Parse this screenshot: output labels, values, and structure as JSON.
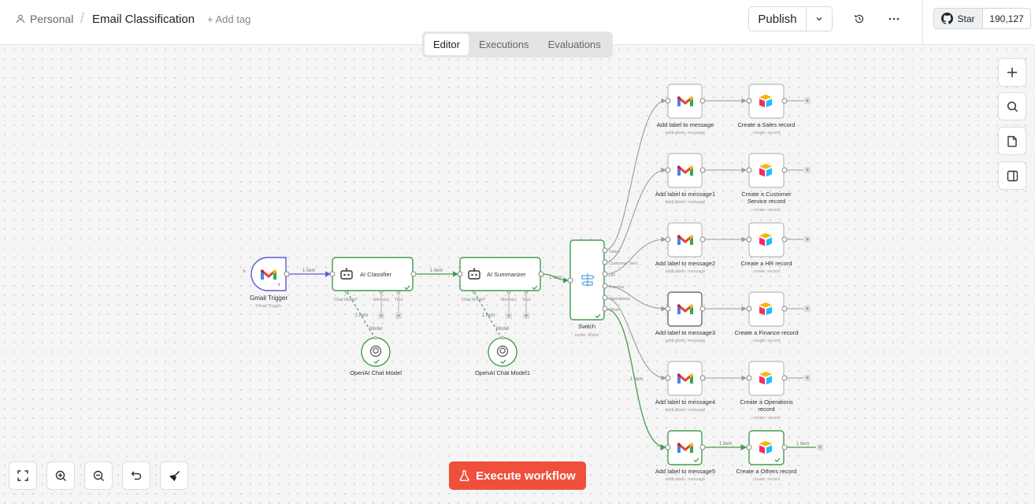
{
  "header": {
    "breadcrumb_project": "Personal",
    "breadcrumb_sep": "/",
    "workflow_name": "Email Classification",
    "add_tag": "+ Add tag",
    "publish": "Publish",
    "github_star": "Star",
    "github_count": "190,127"
  },
  "tabs": [
    {
      "label": "Editor",
      "active": true
    },
    {
      "label": "Executions",
      "active": false
    },
    {
      "label": "Evaluations",
      "active": false
    }
  ],
  "execute_label": "Execute workflow",
  "colors": {
    "accent": "#ef4f3b",
    "success": "#3e9f4f",
    "link": "#5b5bd6"
  },
  "nodes": {
    "gmail_trigger": {
      "title": "Gmail Trigger",
      "subtitle": "Gmail Trigger"
    },
    "ai_classifier": {
      "title": "AI Classifier",
      "ports": [
        "Chat Model*",
        "Memory",
        "Tool"
      ]
    },
    "ai_summarizer": {
      "title": "AI Summarizer",
      "ports": [
        "Chat Model*",
        "Memory",
        "Tool"
      ]
    },
    "openai_1": {
      "title": "OpenAI Chat Model"
    },
    "openai_2": {
      "title": "OpenAI Chat Model1"
    },
    "switch": {
      "title": "Switch",
      "subtitle": "mode: Rules",
      "outputs": [
        "Sales",
        "Customer Serv...",
        "HR",
        "Finance",
        "Operations",
        "Other"
      ]
    },
    "gmail_labels": [
      {
        "title": "Add label to message",
        "subtitle": "addLabels: message"
      },
      {
        "title": "Add label to message1",
        "subtitle": "addLabels: message"
      },
      {
        "title": "Add label to message2",
        "subtitle": "addLabels: message"
      },
      {
        "title": "Add label to message3",
        "subtitle": "addLabels: message"
      },
      {
        "title": "Add label to message4",
        "subtitle": "addLabels: message"
      },
      {
        "title": "Add label to message5",
        "subtitle": "addLabels: message"
      }
    ],
    "airtable": [
      {
        "title": "Create a Sales record",
        "title2": "",
        "subtitle": "create: record"
      },
      {
        "title": "Create a Customer",
        "title2": "Service record",
        "subtitle": "create: record"
      },
      {
        "title": "Create a HR record",
        "title2": "",
        "subtitle": "create: record"
      },
      {
        "title": "Create a Finance record",
        "title2": "",
        "subtitle": "create: record"
      },
      {
        "title": "Create a Operations",
        "title2": "record",
        "subtitle": "create: record"
      },
      {
        "title": "Create a Others record",
        "title2": "",
        "subtitle": "create: record"
      }
    ]
  },
  "edge_labels": {
    "item": "1 item",
    "model": "Model"
  }
}
